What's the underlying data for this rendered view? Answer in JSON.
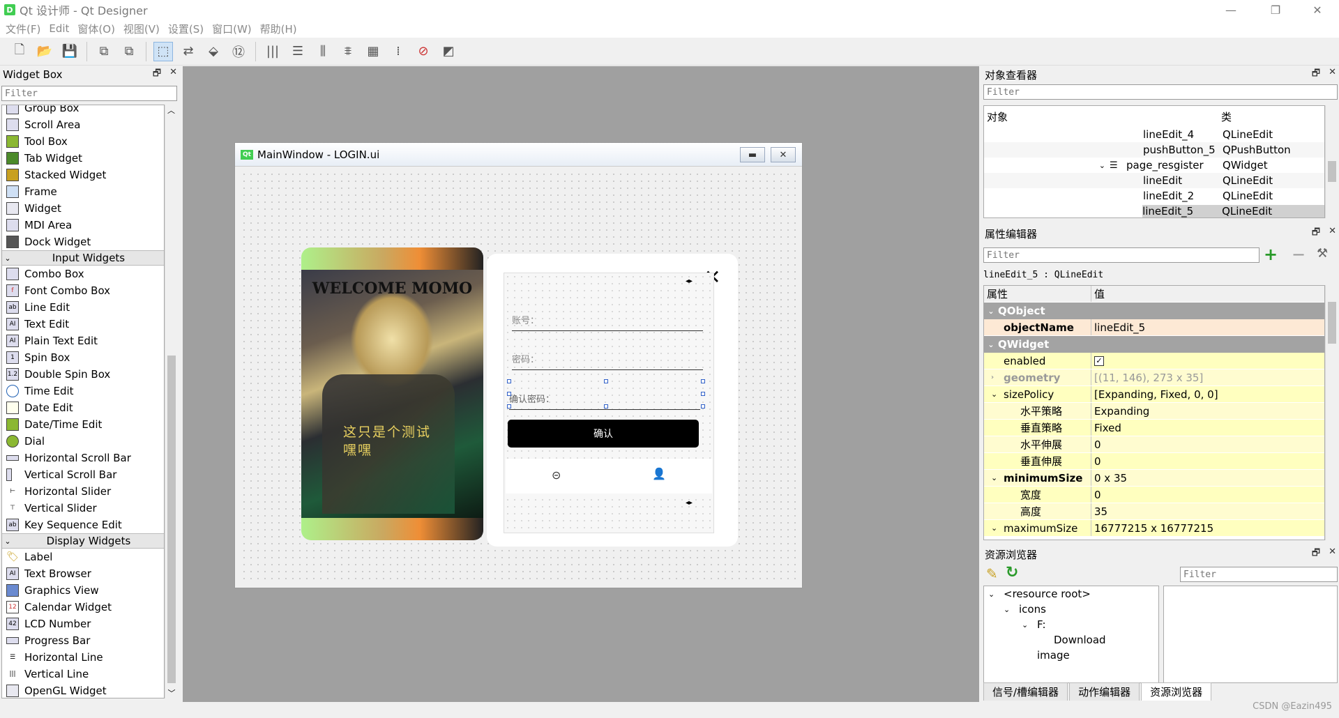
{
  "window": {
    "title": "Qt 设计师 - Qt Designer",
    "app_icon": "D"
  },
  "menu": [
    "文件(F)",
    "Edit",
    "窗体(O)",
    "视图(V)",
    "设置(S)",
    "窗口(W)",
    "帮助(H)"
  ],
  "toolbar_icons": [
    "new-file-icon",
    "open-file-icon",
    "save-icon",
    "bring-front-icon",
    "send-back-icon",
    "edit-widgets-icon",
    "edit-signals-icon",
    "edit-buddies-icon",
    "edit-tab-order-icon",
    "layout-horizontal-icon",
    "layout-vertical-icon",
    "layout-h-splitter-icon",
    "layout-v-splitter-icon",
    "layout-grid-icon",
    "layout-form-icon",
    "break-layout-icon",
    "adjust-size-icon"
  ],
  "widget_box": {
    "title": "Widget Box",
    "filter_placeholder": "Filter",
    "containers": [
      "Group Box",
      "Scroll Area",
      "Tool Box",
      "Tab Widget",
      "Stacked Widget",
      "Frame",
      "Widget",
      "MDI Area",
      "Dock Widget"
    ],
    "input_label": "Input Widgets",
    "inputs": [
      "Combo Box",
      "Font Combo Box",
      "Line Edit",
      "Text Edit",
      "Plain Text Edit",
      "Spin Box",
      "Double Spin Box",
      "Time Edit",
      "Date Edit",
      "Date/Time Edit",
      "Dial",
      "Horizontal Scroll Bar",
      "Vertical Scroll Bar",
      "Horizontal Slider",
      "Vertical Slider",
      "Key Sequence Edit"
    ],
    "display_label": "Display Widgets",
    "displays": [
      "Label",
      "Text Browser",
      "Graphics View",
      "Calendar Widget",
      "LCD Number",
      "Progress Bar",
      "Horizontal Line",
      "Vertical Line",
      "OpenGL Widget"
    ]
  },
  "form": {
    "title": "MainWindow - LOGIN.ui",
    "welcome": "WELCOME MOMO",
    "caption_line1": "这只是个测试",
    "caption_line2": "嘿嘿",
    "close_glyph": "✕",
    "account_placeholder": "账号：",
    "password_placeholder": "密码：",
    "confirm_placeholder": "确认密码：",
    "confirm_button": "确认"
  },
  "object_inspector": {
    "title": "对象查看器",
    "filter_placeholder": "Filter",
    "col_object": "对象",
    "col_class": "类",
    "rows": [
      {
        "name": "lineEdit_4",
        "cls": "QLineEdit"
      },
      {
        "name": "pushButton_5",
        "cls": "QPushButton"
      },
      {
        "name": "page_resgister",
        "cls": "QWidget"
      },
      {
        "name": "lineEdit",
        "cls": "QLineEdit"
      },
      {
        "name": "lineEdit_2",
        "cls": "QLineEdit"
      },
      {
        "name": "lineEdit_5",
        "cls": "QLineEdit"
      }
    ]
  },
  "property_editor": {
    "title": "属性编辑器",
    "filter_placeholder": "Filter",
    "context": "lineEdit_5 : QLineEdit",
    "col_prop": "属性",
    "col_value": "值",
    "cat_qobject": "QObject",
    "cat_qwidget": "QWidget",
    "objectName_k": "objectName",
    "objectName_v": "lineEdit_5",
    "enabled_k": "enabled",
    "geometry_k": "geometry",
    "geometry_v": "[(11, 146), 273 x 35]",
    "sizePolicy_k": "sizePolicy",
    "sizePolicy_v": "[Expanding, Fixed, 0, 0]",
    "hpolicy_k": "水平策略",
    "hpolicy_v": "Expanding",
    "vpolicy_k": "垂直策略",
    "vpolicy_v": "Fixed",
    "hstretch_k": "水平伸展",
    "hstretch_v": "0",
    "vstretch_k": "垂直伸展",
    "vstretch_v": "0",
    "minimumSize_k": "minimumSize",
    "minimumSize_v": "0 x 35",
    "width_k": "宽度",
    "width_v": "0",
    "height_k": "高度",
    "height_v": "35",
    "maximumSize_k": "maximumSize",
    "maximumSize_v": "16777215 x 16777215"
  },
  "resource_browser": {
    "title": "资源浏览器",
    "filter_placeholder": "Filter",
    "root": "<resource root>",
    "icons": "icons",
    "f": "F:",
    "download": "Download",
    "image": "image"
  },
  "bottom_tabs": [
    "信号/槽编辑器",
    "动作编辑器",
    "资源浏览器"
  ],
  "watermark": "CSDN @Eazin495"
}
